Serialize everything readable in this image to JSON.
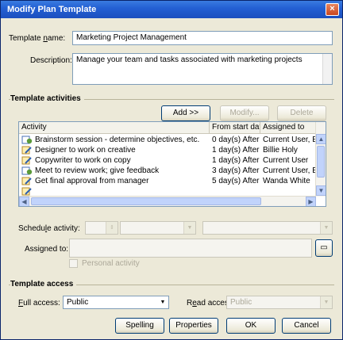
{
  "window": {
    "title": "Modify Plan Template",
    "close_glyph": "×"
  },
  "template_name": {
    "label_pre": "Template ",
    "label_key": "n",
    "label_post": "ame:",
    "value": "Marketing Project Management"
  },
  "description": {
    "label": "Description:",
    "value": "Manage your team and tasks associated with marketing projects"
  },
  "activities": {
    "group_title": "Template activities",
    "add_button": "Add >>",
    "modify_button": "Modify...",
    "delete_button": "Delete",
    "columns": [
      "Activity",
      "From start date",
      "Assigned to"
    ],
    "rows": [
      {
        "icon": "phone-note-icon",
        "activity": "Brainstorm session - determine objectives, etc.",
        "from": "0 day(s) After",
        "assigned": "Current User, E"
      },
      {
        "icon": "task-pencil-icon",
        "activity": "Designer to work on creative",
        "from": "1 day(s) After",
        "assigned": "Billie Holy"
      },
      {
        "icon": "task-pencil-icon",
        "activity": "Copywriter to work on copy",
        "from": "1 day(s) After",
        "assigned": "Current User"
      },
      {
        "icon": "phone-note-icon",
        "activity": "Meet to review work; give feedback",
        "from": "3 day(s) After",
        "assigned": "Current User, E"
      },
      {
        "icon": "task-pencil-icon",
        "activity": "Get final approval from manager",
        "from": "5 day(s) After",
        "assigned": "Wanda White"
      },
      {
        "icon": "task-pencil-icon",
        "activity": "",
        "from": "",
        "assigned": ""
      }
    ]
  },
  "schedule": {
    "label_pre": "Schedu",
    "label_key": "l",
    "label_post": "e activity:",
    "value": "",
    "unit_value": ""
  },
  "assigned": {
    "label": "Assigned to:",
    "value": ""
  },
  "personal": {
    "label": "Personal activity"
  },
  "access": {
    "group_title": "Template access",
    "full_label_key": "F",
    "full_label_post": "ull access:",
    "full_value": "Public",
    "read_label_pre": "R",
    "read_label_key": "e",
    "read_label_post": "ad access:",
    "read_value": "Public"
  },
  "footer": {
    "spelling": "Spelling",
    "properties": "Properties",
    "ok": "OK",
    "cancel": "Cancel"
  },
  "colors": {
    "titlebar": "#2461d4",
    "window_bg": "#ece9d8",
    "border": "#7f9db9"
  }
}
